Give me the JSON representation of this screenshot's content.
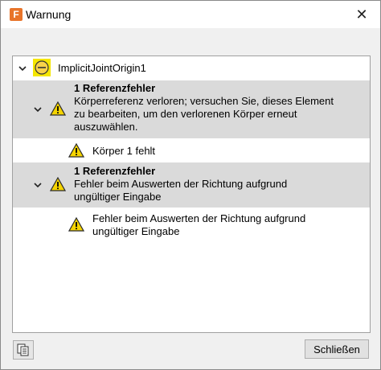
{
  "window": {
    "title": "Warnung",
    "app_icon_letter": "F",
    "close_glyph": "✕"
  },
  "tree": {
    "root": {
      "label": "ImplicitJointOrigin1",
      "icon": "joint-origin-icon"
    },
    "group1": {
      "heading": "1 Referenzfehler",
      "line1": "Körperreferenz verloren; versuchen Sie, dieses Element",
      "line2": "zu bearbeiten, um den verlorenen Körper erneut",
      "line3": "auszuwählen.",
      "child": "Körper 1 fehlt"
    },
    "group2": {
      "heading": "1 Referenzfehler",
      "line1": "Fehler beim Auswerten der Richtung aufgrund",
      "line2": "ungültiger Eingabe",
      "child_line1": "Fehler beim Auswerten der Richtung aufgrund",
      "child_line2": "ungültiger Eingabe"
    }
  },
  "footer": {
    "close_label": "Schließen"
  },
  "colors": {
    "warning_fill": "#f5d400",
    "row_highlight": "#dadada",
    "icon_accent": "#e8742a"
  }
}
